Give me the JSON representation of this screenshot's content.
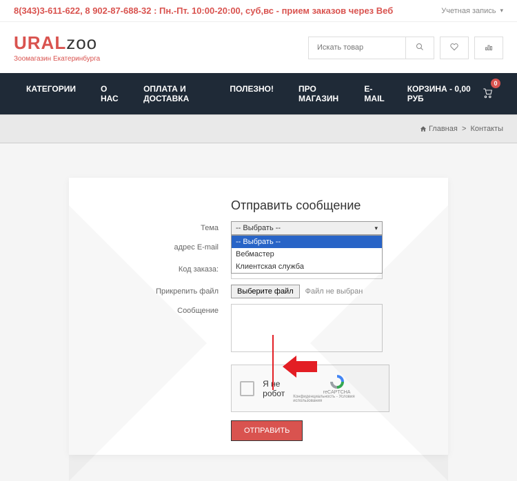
{
  "topbar": {
    "phone_hours": "8(343)3-611-622, 8 902-87-688-32 : Пн.-Пт. 10:00-20:00, суб,вс - прием заказов через Веб",
    "account": "Учетная запись"
  },
  "logo": {
    "brand1": "URAL",
    "brand2": "zoo",
    "tagline": "Зоомагазин Екатеринбурга"
  },
  "search": {
    "placeholder": "Искать товар"
  },
  "nav": {
    "items": [
      "КАТЕГОРИИ",
      "О НАС",
      "ОПЛАТА И ДОСТАВКА",
      "ПОЛЕЗНО!",
      "ПРО МАГАЗИН",
      "E-MAIL"
    ],
    "cart": "КОРЗИНА - 0,00 РУБ",
    "cart_count": "0"
  },
  "breadcrumb": {
    "home": "Главная",
    "current": "Контакты"
  },
  "form": {
    "title": "Отправить сообщение",
    "labels": {
      "topic": "Тема",
      "email": "адрес E-mail",
      "order": "Код заказа:",
      "file": "Прикрепить файл",
      "message": "Сообщение"
    },
    "select_placeholder": "-- Выбрать --",
    "options": [
      "-- Выбрать --",
      "Вебмастер",
      "Клиентская служба"
    ],
    "file_button": "Выберите файл",
    "file_none": "Файл не выбран",
    "captcha": "Я не робот",
    "captcha_brand": "reCAPTCHA",
    "captcha_terms": "Конфиденциальность - Условия использования",
    "submit": "ОТПРАВИТЬ"
  }
}
